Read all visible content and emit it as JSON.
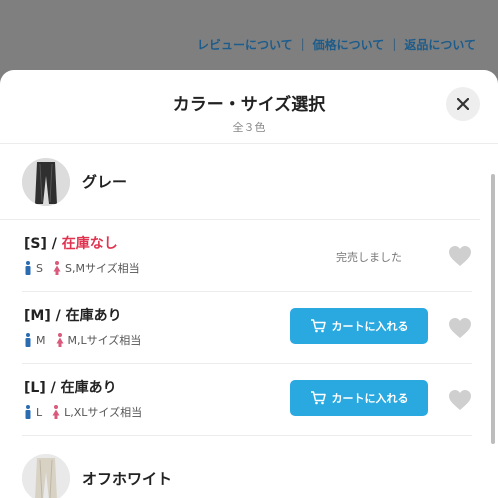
{
  "top_links": [
    "レビューについて",
    "価格について",
    "返品について"
  ],
  "sheet": {
    "title": "カラー・サイズ選択",
    "subtitle": "全３色"
  },
  "colors": [
    {
      "name": "グレー",
      "sizes": [
        {
          "label": "[S] / ",
          "stock": "在庫なし",
          "men": "S",
          "women": "S,Mサイズ相当",
          "status": "完売しました"
        },
        {
          "label": "[M] / ",
          "stock": "在庫あり",
          "men": "M",
          "women": "M,Lサイズ相当",
          "button": "カートに入れる"
        },
        {
          "label": "[L] / ",
          "stock": "在庫あり",
          "men": "L",
          "women": "L,XLサイズ相当",
          "button": "カートに入れる"
        }
      ]
    },
    {
      "name": "オフホワイト"
    }
  ],
  "theme": {
    "accent": "#2aa8e0",
    "out_of_stock": "#e0334f",
    "link": "#1d5c8a"
  }
}
